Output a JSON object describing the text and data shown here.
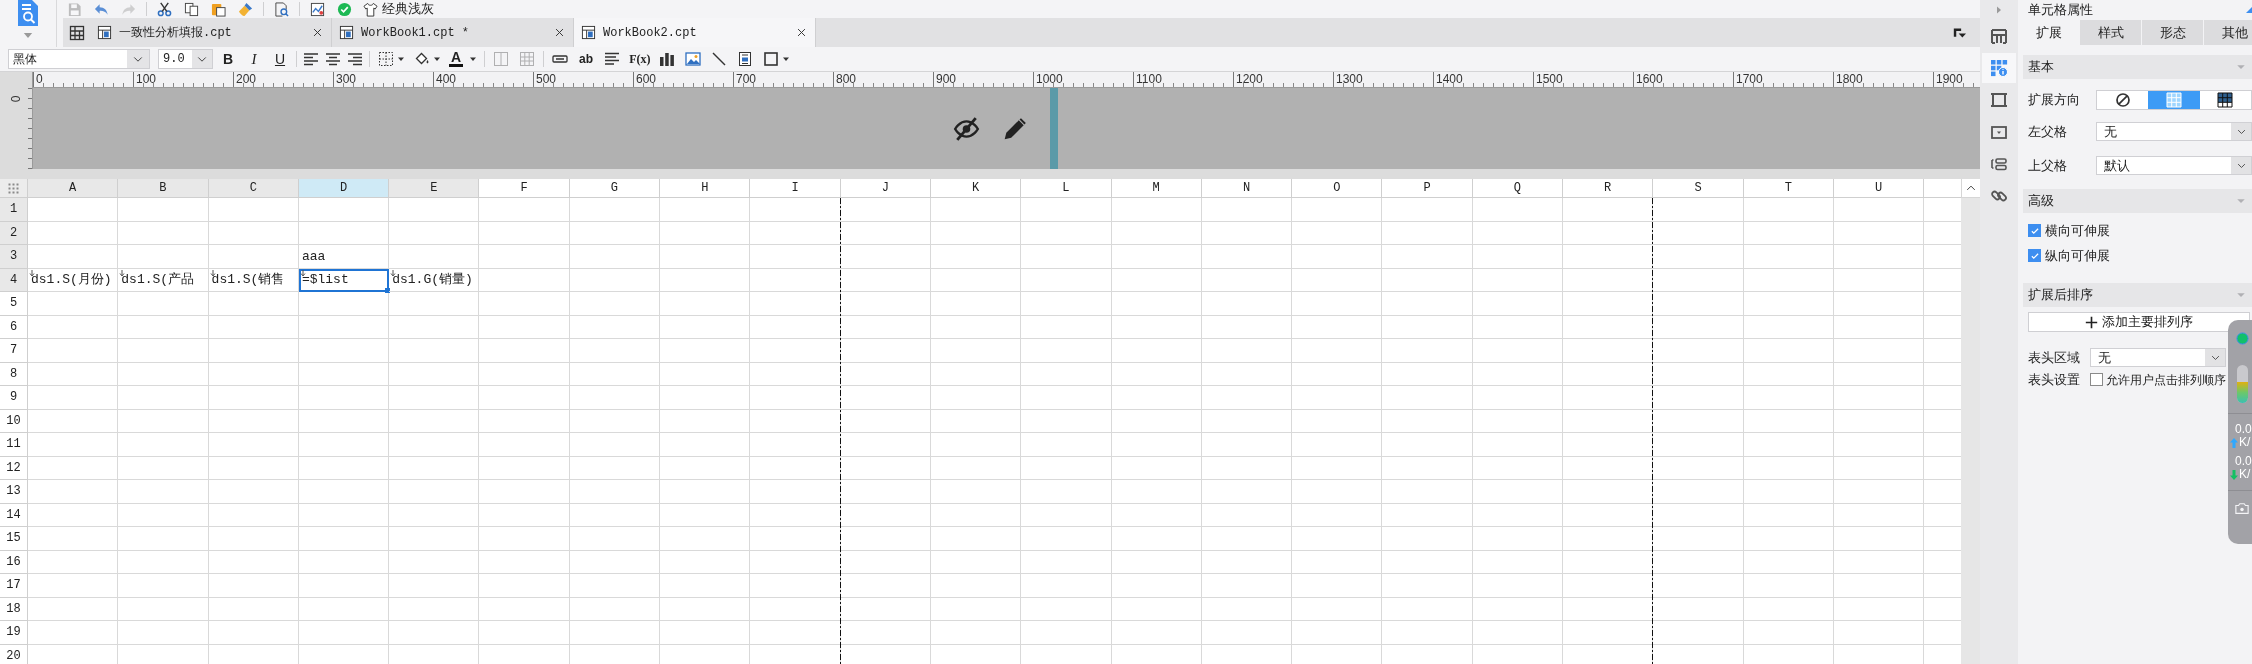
{
  "toolbar": {
    "groups": [
      [
        {
          "kind": "save",
          "disabled": true
        },
        {
          "kind": "undo",
          "disabled": false
        },
        {
          "kind": "redo",
          "disabled": true
        }
      ],
      [
        {
          "kind": "cut",
          "disabled": false
        },
        {
          "kind": "copy",
          "disabled": false
        },
        {
          "kind": "paste",
          "disabled": false
        },
        {
          "kind": "painter",
          "disabled": false
        }
      ],
      [
        {
          "kind": "preview",
          "disabled": false
        }
      ],
      [
        {
          "kind": "chart_preview",
          "disabled": false
        },
        {
          "kind": "check",
          "disabled": false
        },
        {
          "kind": "theme",
          "label": "经典浅灰",
          "disabled": false
        }
      ]
    ]
  },
  "tabs": [
    {
      "label": "一致性分析填报.cpt",
      "selected": false
    },
    {
      "label": "WorkBook1.cpt *",
      "selected": false
    },
    {
      "label": "WorkBook2.cpt",
      "selected": true
    }
  ],
  "format_bar": {
    "font": "黑体",
    "font_size": "9.0",
    "groups": [
      [
        {
          "kind": "bold",
          "label": "B",
          "disabled": false
        },
        {
          "kind": "italic",
          "label": "I",
          "disabled": false
        },
        {
          "kind": "underline",
          "label": "U",
          "disabled": false
        }
      ],
      [
        {
          "kind": "align_left",
          "disabled": false
        },
        {
          "kind": "align_center",
          "disabled": false
        },
        {
          "kind": "align_right",
          "disabled": false
        }
      ],
      [
        {
          "kind": "border",
          "disabled": false
        },
        {
          "kind": "fill",
          "disabled": false
        },
        {
          "kind": "font_color",
          "label": "A",
          "disabled": false
        }
      ],
      [
        {
          "kind": "merge",
          "disabled": true
        },
        {
          "kind": "unmerge",
          "disabled": true
        }
      ],
      [
        {
          "kind": "button_widget",
          "disabled": false
        },
        {
          "kind": "text_widget",
          "label": "ab",
          "disabled": false
        },
        {
          "kind": "rich_text",
          "disabled": false
        },
        {
          "kind": "formula",
          "label": "F(x)",
          "disabled": false
        },
        {
          "kind": "chart",
          "disabled": false
        },
        {
          "kind": "image",
          "disabled": false
        },
        {
          "kind": "slash",
          "disabled": false
        },
        {
          "kind": "subreport",
          "disabled": false
        },
        {
          "kind": "frame",
          "disabled": false
        }
      ]
    ]
  },
  "ruler": {
    "labels": [
      "0",
      "100",
      "200",
      "300",
      "400",
      "500",
      "600",
      "700",
      "800",
      "900",
      "1000",
      "1100",
      "1200",
      "1300",
      "1400",
      "1500",
      "1600",
      "1700",
      "1800",
      "1900"
    ],
    "vertical_label": "0"
  },
  "sheet": {
    "columns": [
      {
        "label": "A",
        "selected": false,
        "in_use": true,
        "page_break": false
      },
      {
        "label": "B",
        "selected": false,
        "in_use": true,
        "page_break": false
      },
      {
        "label": "C",
        "selected": false,
        "in_use": true,
        "page_break": false
      },
      {
        "label": "D",
        "selected": true,
        "in_use": true,
        "page_break": false
      },
      {
        "label": "E",
        "selected": false,
        "in_use": true,
        "page_break": false
      },
      {
        "label": "F",
        "selected": false,
        "in_use": false,
        "page_break": false
      },
      {
        "label": "G",
        "selected": false,
        "in_use": false,
        "page_break": false
      },
      {
        "label": "H",
        "selected": false,
        "in_use": false,
        "page_break": false
      },
      {
        "label": "I",
        "selected": false,
        "in_use": false,
        "page_break": true
      },
      {
        "label": "J",
        "selected": false,
        "in_use": false,
        "page_break": false
      },
      {
        "label": "K",
        "selected": false,
        "in_use": false,
        "page_break": false
      },
      {
        "label": "L",
        "selected": false,
        "in_use": false,
        "page_break": false
      },
      {
        "label": "M",
        "selected": false,
        "in_use": false,
        "page_break": false
      },
      {
        "label": "N",
        "selected": false,
        "in_use": false,
        "page_break": false
      },
      {
        "label": "O",
        "selected": false,
        "in_use": false,
        "page_break": false
      },
      {
        "label": "P",
        "selected": false,
        "in_use": false,
        "page_break": false
      },
      {
        "label": "Q",
        "selected": false,
        "in_use": false,
        "page_break": false
      },
      {
        "label": "R",
        "selected": false,
        "in_use": false,
        "page_break": true
      },
      {
        "label": "S",
        "selected": false,
        "in_use": false,
        "page_break": false
      },
      {
        "label": "T",
        "selected": false,
        "in_use": false,
        "page_break": false
      },
      {
        "label": "U",
        "selected": false,
        "in_use": false,
        "page_break": false
      }
    ],
    "rows": [
      {
        "number": "1",
        "in_use": true
      },
      {
        "number": "2",
        "in_use": true
      },
      {
        "number": "3",
        "in_use": true,
        "cells": [
          null,
          null,
          null,
          {
            "text": "aaa",
            "selected": false,
            "expand_marker": false
          }
        ]
      },
      {
        "number": "4",
        "in_use": true,
        "cells": [
          {
            "text": "ds1.S(月份)",
            "selected": false,
            "expand_marker": true
          },
          {
            "text": "ds1.S(产品",
            "selected": false,
            "expand_marker": true
          },
          {
            "text": "ds1.S(销售",
            "selected": false,
            "expand_marker": true
          },
          {
            "text": "=$list",
            "selected": true,
            "expand_marker": true
          },
          {
            "text": "ds1.G(销量)",
            "selected": false,
            "expand_marker": true
          }
        ]
      },
      {
        "number": "5",
        "in_use": false
      },
      {
        "number": "6",
        "in_use": false
      },
      {
        "number": "7",
        "in_use": false
      },
      {
        "number": "8",
        "in_use": false
      },
      {
        "number": "9",
        "in_use": false
      },
      {
        "number": "10",
        "in_use": false
      },
      {
        "number": "11",
        "in_use": false
      },
      {
        "number": "12",
        "in_use": false
      },
      {
        "number": "13",
        "in_use": false
      },
      {
        "number": "14",
        "in_use": false
      },
      {
        "number": "15",
        "in_use": false
      },
      {
        "number": "16",
        "in_use": false
      },
      {
        "number": "17",
        "in_use": false
      },
      {
        "number": "18",
        "in_use": false
      },
      {
        "number": "19",
        "in_use": false
      },
      {
        "number": "20",
        "in_use": false
      }
    ]
  },
  "side_tabs": [
    {
      "kind": "table",
      "selected": false
    },
    {
      "kind": "cell",
      "selected": true
    },
    {
      "kind": "frame",
      "selected": false
    },
    {
      "kind": "widget",
      "selected": false
    },
    {
      "kind": "condition",
      "selected": false
    },
    {
      "kind": "link",
      "selected": false
    }
  ],
  "cell_properties": {
    "title": "单元格属性",
    "tabs": [
      {
        "label": "扩展",
        "selected": true
      },
      {
        "label": "样式",
        "selected": false
      },
      {
        "label": "形态",
        "selected": false
      },
      {
        "label": "其他",
        "selected": false
      }
    ],
    "basic": {
      "title": "基本",
      "expanded": true,
      "direction": {
        "label": "扩展方向",
        "options": [
          {
            "kind": "none",
            "selected": false
          },
          {
            "kind": "vertical",
            "selected": true
          },
          {
            "kind": "horizontal",
            "selected": false
          }
        ]
      },
      "left_parent": {
        "label": "左父格",
        "value": "无"
      },
      "top_parent": {
        "label": "上父格",
        "value": "默认"
      }
    },
    "advanced": {
      "title": "高级",
      "expanded": true,
      "options": [
        {
          "label": "横向可伸展",
          "checked": true
        },
        {
          "label": "纵向可伸展",
          "checked": true
        }
      ]
    },
    "sorting": {
      "title": "扩展后排序",
      "expanded": true,
      "add_button": "添加主要排列序",
      "header_area": {
        "label": "表头区域",
        "value": "无"
      },
      "header_settings": {
        "label": "表头设置",
        "option": {
          "label": "允许用户点击排列顺序",
          "checked": false
        }
      }
    }
  },
  "monitor": {
    "level": 0.55,
    "readings": [
      {
        "kind": "upload",
        "value": "0.0",
        "unit": "K/"
      },
      {
        "kind": "download",
        "value": "0.0",
        "unit": "K/"
      }
    ]
  }
}
